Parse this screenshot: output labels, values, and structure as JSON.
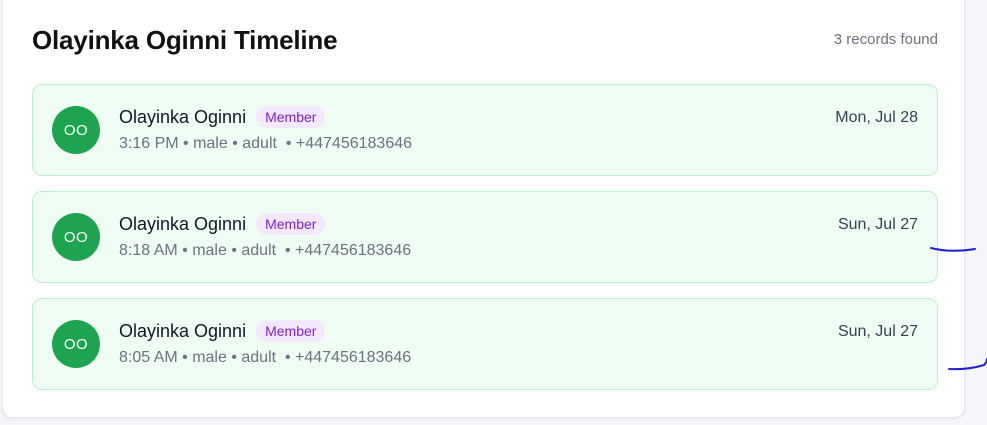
{
  "timeline": {
    "title": "Olayinka Oginni Timeline",
    "record_count": "3 records found",
    "colors": {
      "card_background": "#effcf3",
      "card_border": "#bbf1cc",
      "avatar": "#1ea450",
      "badge_background": "#f3e8ff",
      "badge_text": "#7e22ce",
      "annotation_ink": "#1f1fd6"
    },
    "records": [
      {
        "initials": "OO",
        "name": "Olayinka Oginni",
        "role": "Member",
        "meta": "3:16 PM • male • adult  • +447456183646",
        "date": "Mon, Jul 28"
      },
      {
        "initials": "OO",
        "name": "Olayinka Oginni",
        "role": "Member",
        "meta": "8:18 AM • male • adult  • +447456183646",
        "date": "Sun, Jul 27"
      },
      {
        "initials": "OO",
        "name": "Olayinka Oginni",
        "role": "Member",
        "meta": "8:05 AM • male • adult  • +447456183646",
        "date": "Sun, Jul 27"
      }
    ]
  }
}
